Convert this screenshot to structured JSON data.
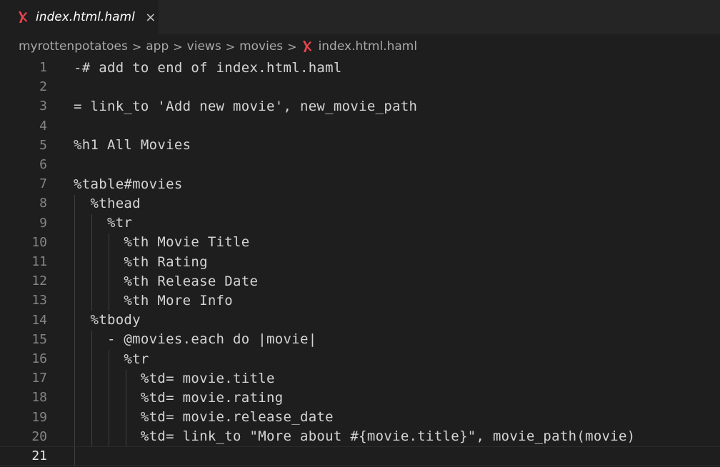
{
  "tab": {
    "label": "index.html.haml",
    "close_icon": "×",
    "file_icon": "haml-file-icon",
    "icon_color": "#f0434c"
  },
  "breadcrumb": {
    "items": [
      "myrottenpotatoes",
      "app",
      "views",
      "movies"
    ],
    "file": "index.html.haml",
    "separator": ">"
  },
  "editor": {
    "current_line": 21,
    "lines": [
      {
        "n": "1",
        "text": "-# add to end of index.html.haml"
      },
      {
        "n": "2",
        "text": ""
      },
      {
        "n": "3",
        "text": "= link_to 'Add new movie', new_movie_path"
      },
      {
        "n": "4",
        "text": ""
      },
      {
        "n": "5",
        "text": "%h1 All Movies"
      },
      {
        "n": "6",
        "text": ""
      },
      {
        "n": "7",
        "text": "%table#movies"
      },
      {
        "n": "8",
        "text": "  %thead"
      },
      {
        "n": "9",
        "text": "    %tr"
      },
      {
        "n": "10",
        "text": "      %th Movie Title"
      },
      {
        "n": "11",
        "text": "      %th Rating"
      },
      {
        "n": "12",
        "text": "      %th Release Date"
      },
      {
        "n": "13",
        "text": "      %th More Info"
      },
      {
        "n": "14",
        "text": "  %tbody"
      },
      {
        "n": "15",
        "text": "    - @movies.each do |movie|"
      },
      {
        "n": "16",
        "text": "      %tr"
      },
      {
        "n": "17",
        "text": "        %td= movie.title"
      },
      {
        "n": "18",
        "text": "        %td= movie.rating"
      },
      {
        "n": "19",
        "text": "        %td= movie.release_date"
      },
      {
        "n": "20",
        "text": "        %td= link_to \"More about #{movie.title}\", movie_path(movie)"
      },
      {
        "n": "21",
        "text": ""
      }
    ]
  }
}
